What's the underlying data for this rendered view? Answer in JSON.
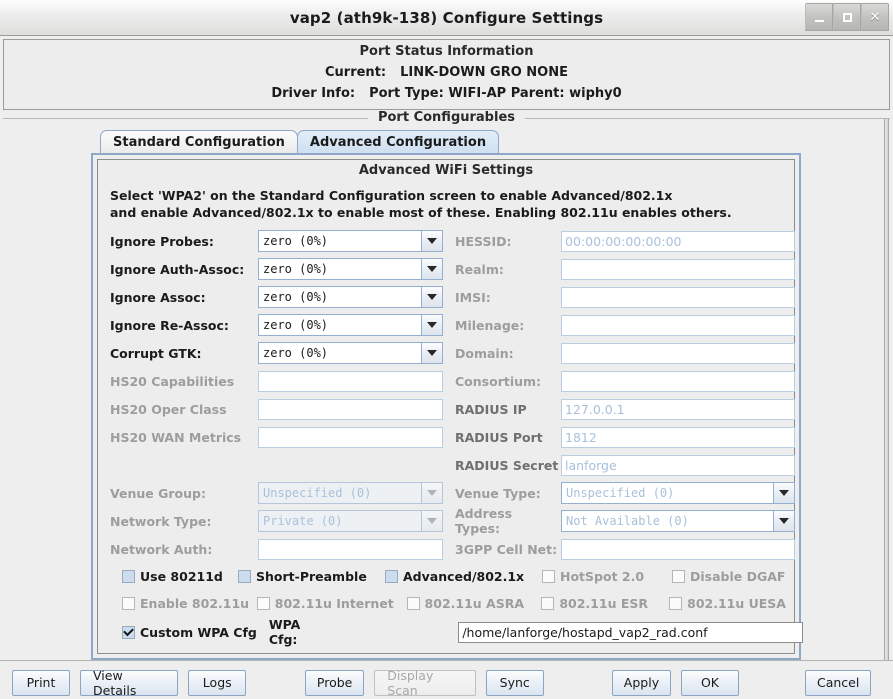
{
  "window": {
    "title": "vap2  (ath9k-138) Configure Settings",
    "minimize_label": "_",
    "maximize_label": "□",
    "close_label": "✕"
  },
  "status_panel": {
    "title": "Port Status Information",
    "current_label": "Current:",
    "current_value": "LINK-DOWN GRO  NONE",
    "driver_label": "Driver Info:",
    "driver_value": "Port Type: WIFI-AP   Parent: wiphy0"
  },
  "configurables": {
    "title": "Port Configurables",
    "tabs": [
      {
        "label": "Standard Configuration",
        "active": false
      },
      {
        "label": "Advanced Configuration",
        "active": true
      }
    ]
  },
  "advanced": {
    "title": "Advanced WiFi Settings",
    "description_line1": "Select 'WPA2' on the Standard Configuration screen to enable Advanced/802.1x",
    "description_line2": "and enable Advanced/802.1x to enable most of these. Enabling 802.11u enables others.",
    "rows": [
      {
        "left_label": "Ignore Probes:",
        "left_value": "zero (0%)",
        "right_label": "HESSID:",
        "right_value": "00:00:00:00:00:00"
      },
      {
        "left_label": "Ignore Auth-Assoc:",
        "left_value": "zero (0%)",
        "right_label": "Realm:",
        "right_value": ""
      },
      {
        "left_label": "Ignore Assoc:",
        "left_value": "zero (0%)",
        "right_label": "IMSI:",
        "right_value": ""
      },
      {
        "left_label": "Ignore Re-Assoc:",
        "left_value": "zero (0%)",
        "right_label": "Milenage:",
        "right_value": ""
      },
      {
        "left_label": "Corrupt GTK:",
        "left_value": "zero (0%)",
        "right_label": "Domain:",
        "right_value": ""
      }
    ],
    "hs20_rows": [
      {
        "left_label": "HS20 Capabilities",
        "left_value": "",
        "right_label": "Consortium:",
        "right_value": ""
      },
      {
        "left_label": "HS20 Oper Class",
        "left_value": "",
        "right_label": "RADIUS IP",
        "right_value": "127.0.0.1"
      },
      {
        "left_label": "HS20 WAN Metrics",
        "left_value": "",
        "right_label": "RADIUS Port",
        "right_value": "1812"
      },
      {
        "left_label": "",
        "left_value": null,
        "right_label": "RADIUS Secret",
        "right_value": "lanforge"
      }
    ],
    "venue_rows": [
      {
        "left_label": "Venue Group:",
        "left_value": "Unspecified (0)",
        "right_label": "Venue Type:",
        "right_value": "Unspecified (0)"
      },
      {
        "left_label": "Network Type:",
        "left_value": "Private (0)",
        "right_label": "Address Types:",
        "right_value": "Not Available (0)"
      }
    ],
    "network_auth": {
      "left_label": "Network Auth:",
      "left_value": "",
      "right_label": "3GPP Cell Net:",
      "right_value": ""
    },
    "checkboxes_row1": [
      {
        "label": "Use 80211d",
        "checked": false,
        "enabled": true
      },
      {
        "label": "Short-Preamble",
        "checked": false,
        "enabled": true
      },
      {
        "label": "Advanced/802.1x",
        "checked": false,
        "enabled": true
      },
      {
        "label": "HotSpot 2.0",
        "checked": false,
        "enabled": false
      },
      {
        "label": "Disable DGAF",
        "checked": false,
        "enabled": false
      }
    ],
    "checkboxes_row2": [
      {
        "label": "Enable 802.11u",
        "checked": false,
        "enabled": false
      },
      {
        "label": "802.11u Internet",
        "checked": false,
        "enabled": false
      },
      {
        "label": "802.11u ASRA",
        "checked": false,
        "enabled": false
      },
      {
        "label": "802.11u ESR",
        "checked": false,
        "enabled": false
      },
      {
        "label": "802.11u UESA",
        "checked": false,
        "enabled": false
      }
    ],
    "wpa_cfg": {
      "checkbox_label": "Custom WPA Cfg",
      "checked": true,
      "field_label": "WPA Cfg:",
      "value": "/home/lanforge/hostapd_vap2_rad.conf"
    }
  },
  "buttons": [
    {
      "label": "Print",
      "enabled": true
    },
    {
      "label": "View Details",
      "enabled": true
    },
    {
      "label": "Logs",
      "enabled": true
    },
    {
      "label": "Probe",
      "enabled": true
    },
    {
      "label": "Display Scan",
      "enabled": false
    },
    {
      "label": "Sync",
      "enabled": true
    },
    {
      "label": "Apply",
      "enabled": true
    },
    {
      "label": "OK",
      "enabled": true
    },
    {
      "label": "Cancel",
      "enabled": true
    }
  ]
}
